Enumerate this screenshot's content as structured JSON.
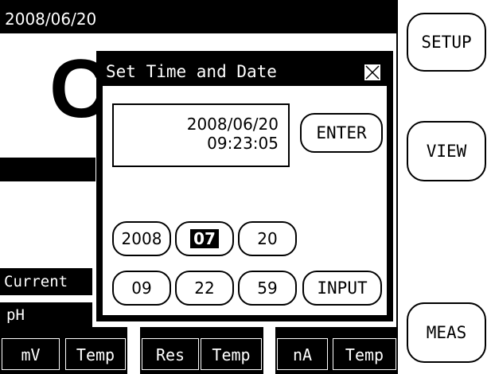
{
  "header": {
    "date": "2008/06/20"
  },
  "main": {
    "big_char": "C",
    "current_label": "Current",
    "ph_label": "pH"
  },
  "bottom": {
    "cells": [
      {
        "label": "mV"
      },
      {
        "label": "Temp"
      },
      {
        "label": "Res"
      },
      {
        "label": "Temp"
      },
      {
        "label": "nA"
      },
      {
        "label": "Temp"
      }
    ]
  },
  "side_buttons": {
    "setup": "SETUP",
    "view": "VIEW",
    "meas": "MEAS"
  },
  "dialog": {
    "title": "Set Time and Date",
    "display_date": "2008/06/20",
    "display_time": "09:23:05",
    "enter_label": "ENTER",
    "input_label": "INPUT",
    "year": "2008",
    "month": "07",
    "day": "20",
    "hour": "09",
    "minute": "22",
    "second": "59"
  },
  "colors": {
    "background": "#ffffff",
    "foreground": "#000000",
    "selected_fill": "#000000"
  }
}
